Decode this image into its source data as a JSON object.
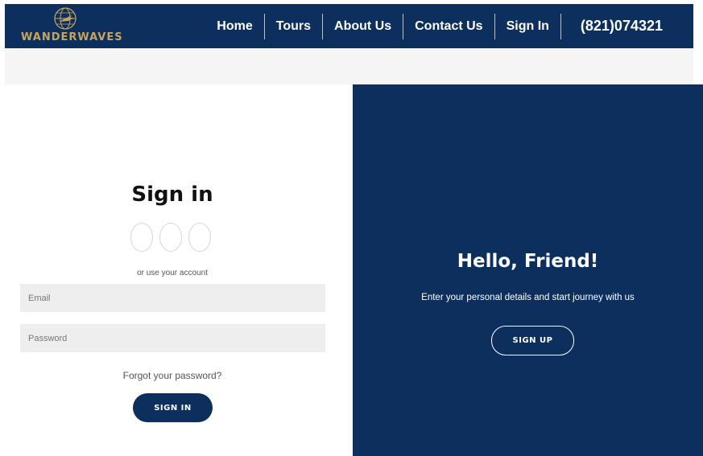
{
  "brand": {
    "logo_text": "WANDERWAVES",
    "color_gold": "#c9a55b",
    "color_navy": "#0c2f5e"
  },
  "nav": {
    "items": [
      {
        "label": "Home"
      },
      {
        "label": "Tours"
      },
      {
        "label": "About Us"
      },
      {
        "label": "Contact Us"
      },
      {
        "label": "Sign In"
      }
    ],
    "phone": "(821)074321"
  },
  "signin": {
    "title": "Sign in",
    "or_text": "or use your account",
    "email_placeholder": "Email",
    "password_placeholder": "Password",
    "forgot_text": "Forgot your password?",
    "button_label": "SIGN IN"
  },
  "welcome": {
    "title": "Hello, Friend!",
    "subtitle": "Enter your personal details and start journey with us",
    "button_label": "SIGN UP"
  },
  "icons": [
    "globe-icon",
    "social-icon"
  ]
}
